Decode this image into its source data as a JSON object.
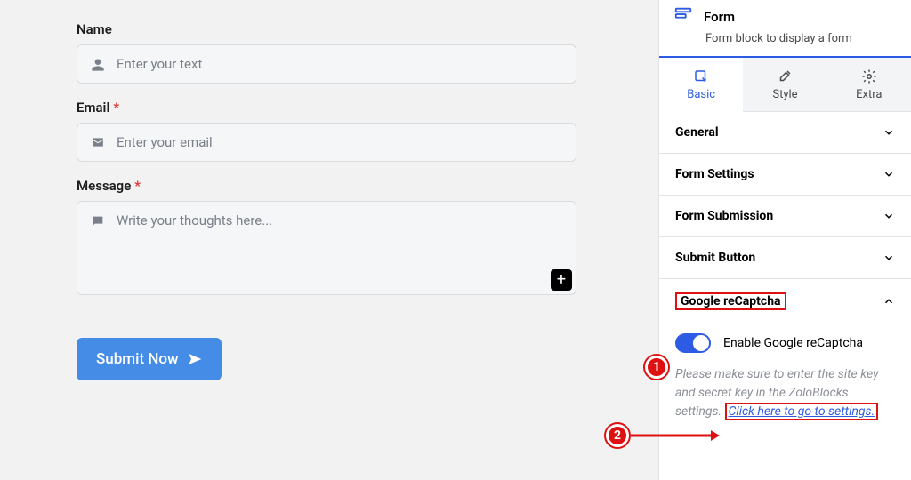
{
  "form": {
    "fields": {
      "name": {
        "label": "Name",
        "placeholder": "Enter your text",
        "required": false
      },
      "email": {
        "label": "Email",
        "placeholder": "Enter your email",
        "required": true
      },
      "message": {
        "label": "Message",
        "placeholder": "Write your thoughts here...",
        "required": true
      }
    },
    "submit_label": "Submit Now"
  },
  "sidebar": {
    "block_title": "Form",
    "block_desc": "Form block to display a form",
    "tabs": {
      "basic": "Basic",
      "style": "Style",
      "extra": "Extra"
    },
    "accordion": {
      "general": "General",
      "form_settings": "Form Settings",
      "form_submission": "Form Submission",
      "submit_button": "Submit Button",
      "recaptcha": "Google reCaptcha"
    },
    "recaptcha": {
      "toggle_label": "Enable Google reCaptcha",
      "hint_prefix": "Please make sure to enter the site key and secret key in the ZoloBlocks settings. ",
      "hint_link": "Click here to go to settings."
    }
  },
  "callouts": {
    "one": "1",
    "two": "2"
  }
}
